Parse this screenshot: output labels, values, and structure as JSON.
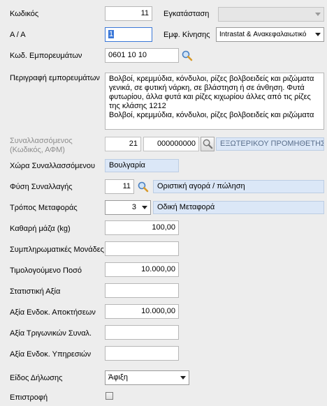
{
  "labels": {
    "code": "Κωδικός",
    "aa": "Α / Α",
    "goods_code": "Κωδ. Εμπορευμάτων",
    "goods_description": "Περιγραφή εμπορευμάτων",
    "trader": "Συναλλασσόμενος\n(Κωδικός, ΑΦΜ)",
    "trader_country": "Χώρα Συναλλασσόμενου",
    "transaction_nature": "Φύση Συναλλαγής",
    "transport_mode": "Τρόπος Μεταφοράς",
    "net_mass": "Καθαρή μάζα (kg)",
    "supplementary_units": "Συμπληρωματικές Μονάδες",
    "invoiced_amount": "Τιμολογούμενο Ποσό",
    "statistical_value": "Στατιστική Αξία",
    "internal_shipments_value": "Αξία Ενδοκ. Αποκτήσεων",
    "triangular_value": "Αξία Τριγωνικών Συναλ.",
    "internal_services_value": "Αξία Ενδοκ. Υπηρεσιών",
    "declaration_type": "Είδος Δήλωσης",
    "return": "Επιστροφή",
    "facility": "Εγκατάσταση",
    "movement_display": "Εμφ. Κίνησης"
  },
  "values": {
    "code": "11",
    "aa": "1",
    "goods_code": "0601 10 10",
    "goods_description": "Βολβοί, κρεμμύδια, κόνδυλοι, ρίζες βολβοειδείς και ριζώματα γενικά, σε φυτική νάρκη, σε βλάστηση ή σε άνθηση. Φυτά φυτωρίου, άλλα φυτά και ρίζες κιχωρίου άλλες από τις ρίζες της κλάσης 1212\nΒολβοί, κρεμμύδια, κόνδυλοι, ρίζες βολβοειδείς και ριζώματα",
    "trader_code": "21",
    "trader_afm": "000000000",
    "trader_name": "ΕΞΩΤΕΡΙΚΟΥ ΠΡΟΜΗΘΕΤΗΣ",
    "trader_country": "Βουλγαρία",
    "transaction_nature_code": "11",
    "transaction_nature_desc": "Οριστική αγορά / πώληση",
    "transport_mode_code": "3",
    "transport_mode_desc": "Οδική Μεταφορά",
    "net_mass": "100,00",
    "supplementary_units": "",
    "invoiced_amount": "10.000,00",
    "statistical_value": "",
    "internal_shipments_value": "10.000,00",
    "triangular_value": "",
    "internal_services_value": "",
    "declaration_type": "Άφιξη",
    "return_checked": false,
    "facility": "",
    "movement_display": "Intrastat & Ανακεφαλαιωτικό"
  },
  "colors": {
    "background": "#ededed",
    "readonly_field": "#dbe7f7",
    "muted_label": "#8c8c8c"
  }
}
